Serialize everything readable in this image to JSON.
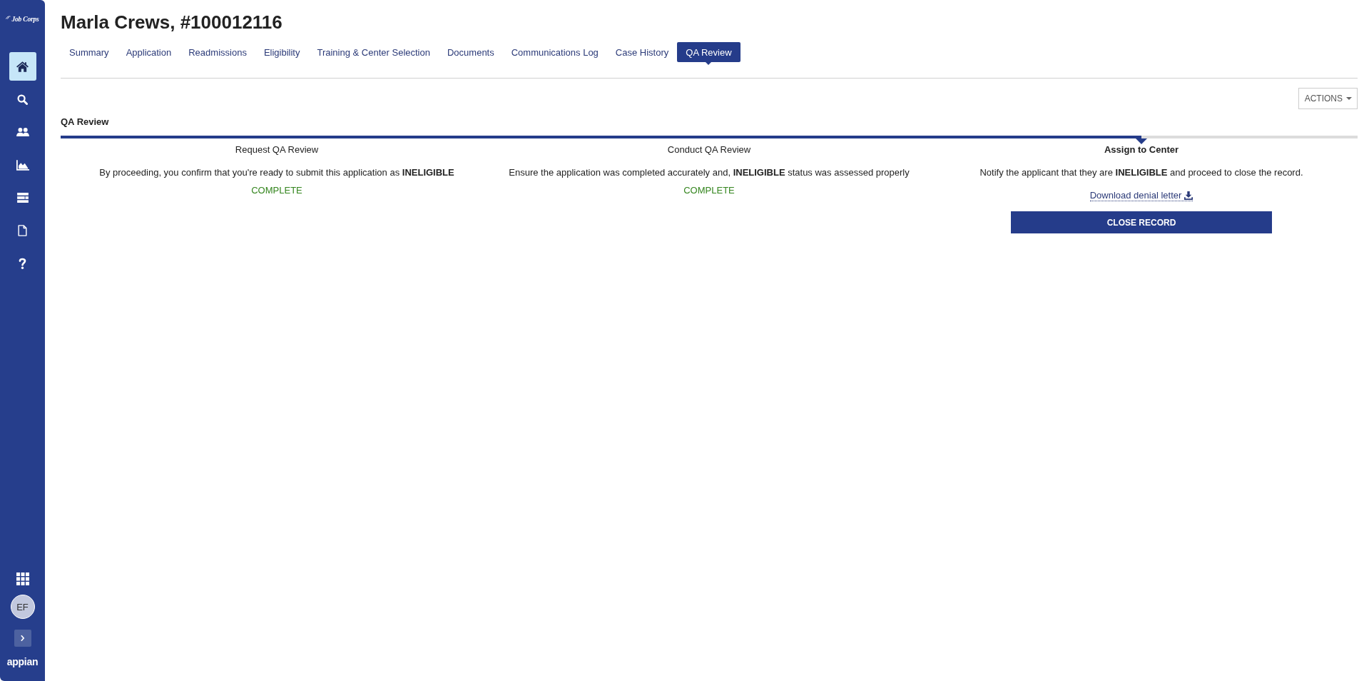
{
  "sidebar": {
    "logo": "Job Corps",
    "nav": [
      {
        "kind": "home",
        "selected": true
      },
      {
        "kind": "search",
        "selected": false
      },
      {
        "kind": "people",
        "selected": false
      },
      {
        "kind": "chart",
        "selected": false
      },
      {
        "kind": "list",
        "selected": false
      },
      {
        "kind": "document",
        "selected": false
      },
      {
        "kind": "help",
        "selected": false
      }
    ],
    "user_initials": "EF",
    "brand": "appian"
  },
  "record": {
    "title": "Marla Crews, #100012116"
  },
  "tabs": [
    {
      "label": "Summary",
      "selected": false
    },
    {
      "label": "Application",
      "selected": false
    },
    {
      "label": "Readmissions",
      "selected": false
    },
    {
      "label": "Eligibility",
      "selected": false
    },
    {
      "label": "Training & Center Selection",
      "selected": false
    },
    {
      "label": "Documents",
      "selected": false
    },
    {
      "label": "Communications Log",
      "selected": false
    },
    {
      "label": "Case History",
      "selected": false
    },
    {
      "label": "QA Review",
      "selected": true
    }
  ],
  "actions_button": {
    "label": "ACTIONS"
  },
  "section": {
    "title": "QA Review"
  },
  "steps": [
    {
      "title": "Request QA Review",
      "current": false,
      "description": "By proceeding, you confirm that you're ready to submit this application as **INELIGIBLE**",
      "status": "COMPLETE"
    },
    {
      "title": "Conduct QA Review",
      "current": false,
      "description": "Ensure the application was completed accurately and, **INELIGIBLE** status was assessed properly",
      "status": "COMPLETE"
    },
    {
      "title": "Assign to Center",
      "current": true,
      "description": "Notify the applicant that they are **INELIGIBLE** and proceed to close the record.",
      "link": "Download denial letter",
      "button": "CLOSE RECORD"
    }
  ]
}
